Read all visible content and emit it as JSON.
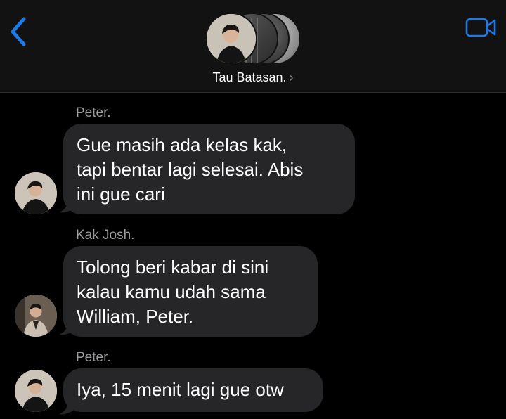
{
  "header": {
    "group_name": "Tau Batasan.",
    "chevron": "›",
    "back_icon": "chevron-left-icon",
    "video_icon": "video-camera-icon",
    "accent_color": "#1e7ae6"
  },
  "messages": [
    {
      "sender": "Peter.",
      "lines": [
        "Gue masih ada kelas kak,",
        "tapi bentar lagi selesai. Abis",
        "ini gue cari"
      ]
    },
    {
      "sender": "Kak Josh.",
      "lines": [
        "Tolong beri kabar di sini",
        "kalau kamu udah sama",
        "William, Peter."
      ]
    },
    {
      "sender": "Peter.",
      "lines": [
        "Iya, 15 menit lagi gue otw"
      ]
    }
  ],
  "colors": {
    "background": "#000000",
    "bubble": "#262628",
    "sender_label": "#9a9a9f"
  }
}
